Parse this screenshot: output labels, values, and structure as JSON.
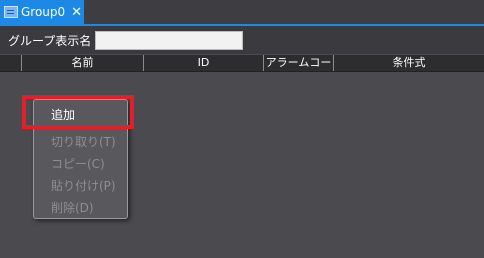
{
  "tab": {
    "label": "Group0",
    "close_glyph": "✕",
    "icon": "group-table-icon"
  },
  "group_name": {
    "label": "グループ表示名",
    "value": "",
    "placeholder": ""
  },
  "table": {
    "columns": [
      "",
      "名前",
      "ID",
      "アラームコード",
      "条件式"
    ],
    "rows": []
  },
  "context_menu": {
    "items": [
      {
        "label": "追加",
        "enabled": true
      },
      {
        "label": "切り取り(T)",
        "enabled": false
      },
      {
        "label": "コピー(C)",
        "enabled": false
      },
      {
        "label": "貼り付け(P)",
        "enabled": false
      },
      {
        "label": "削除(D)",
        "enabled": false
      }
    ]
  },
  "colors": {
    "accent": "#1e88e5",
    "highlight": "#e0202b",
    "background": "#4a4a4f"
  }
}
